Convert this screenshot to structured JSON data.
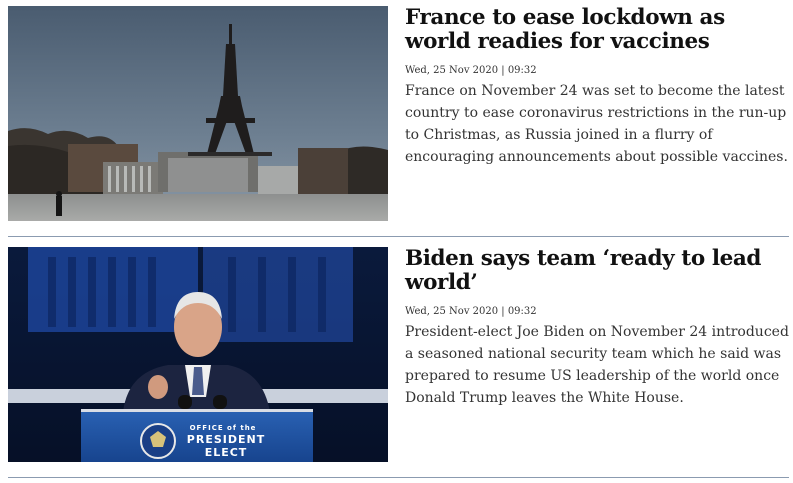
{
  "articles": [
    {
      "headline": "France to ease lockdown as world readies for vaccines",
      "date": "Wed, 25 Nov 2020 | 09:32",
      "summary": "France on November 24 was set to become the latest country to ease coronavirus restrictions in the run-up to Christmas, as Russia joined in a flurry of encouraging announcements about possible vaccines.",
      "image_icon": "eiffel-tower-photo"
    },
    {
      "headline": "Biden says team ‘ready to lead world’",
      "date": "Wed, 25 Nov 2020 | 09:32",
      "summary": "President-elect Joe Biden on November 24 introduced a seasoned national security team which he said was prepared to resume US leadership of the world once Donald Trump leaves the White House.",
      "image_icon": "president-elect-podium-photo",
      "image_text": {
        "podium_line1": "OFFICE of the",
        "podium_line2": "PRESIDENT",
        "podium_line3": "ELECT"
      }
    }
  ],
  "colors": {
    "headline": "#111111",
    "body_text": "#333333",
    "divider": "#8b9bb0",
    "podium_blue": "#1d4f9c"
  }
}
